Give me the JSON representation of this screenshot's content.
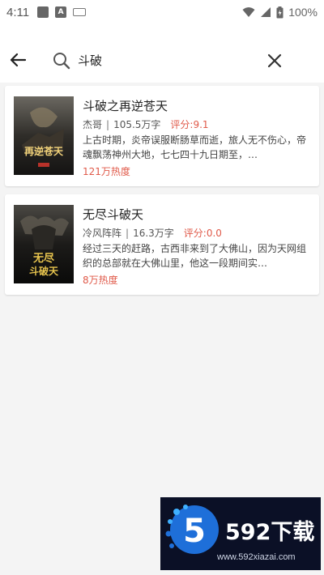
{
  "status_bar": {
    "time": "4:11",
    "battery": "100%"
  },
  "search": {
    "query": "斗破",
    "icons": {
      "back": "arrow-left-icon",
      "search": "search-icon",
      "clear": "close-icon"
    }
  },
  "results": [
    {
      "title": "斗破之再逆苍天",
      "author": "杰哥",
      "words": "105.5万字",
      "score": "评分:9.1",
      "description": "上古时期，炎帝误服断肠草而逝，旅人无不伤心，帝魂飘荡神州大地，七七四十九日期至，…",
      "heat": "121万热度",
      "cover_text": "再逆苍天",
      "cover_colors": [
        "#5d5a55",
        "#2a2823",
        "#c9a24a"
      ]
    },
    {
      "title": "无尽斗破天",
      "author": "冷风阵阵",
      "words": "16.3万字",
      "score": "评分:0.0",
      "description": "经过三天的赶路，古西非来到了大佛山，因为天网组织的总部就在大佛山里，他这一段期间实…",
      "heat": "8万热度",
      "cover_text": "无尽斗破天",
      "cover_colors": [
        "#3a3a36",
        "#111111",
        "#e2c14a"
      ]
    }
  ],
  "watermark": {
    "logo_number": "5",
    "brand": "592下载",
    "site": "www.592xiazai.com",
    "accent": "#1e6fd9"
  },
  "colors": {
    "score_red": "#e05a4a",
    "background": "#f4f4f4"
  }
}
